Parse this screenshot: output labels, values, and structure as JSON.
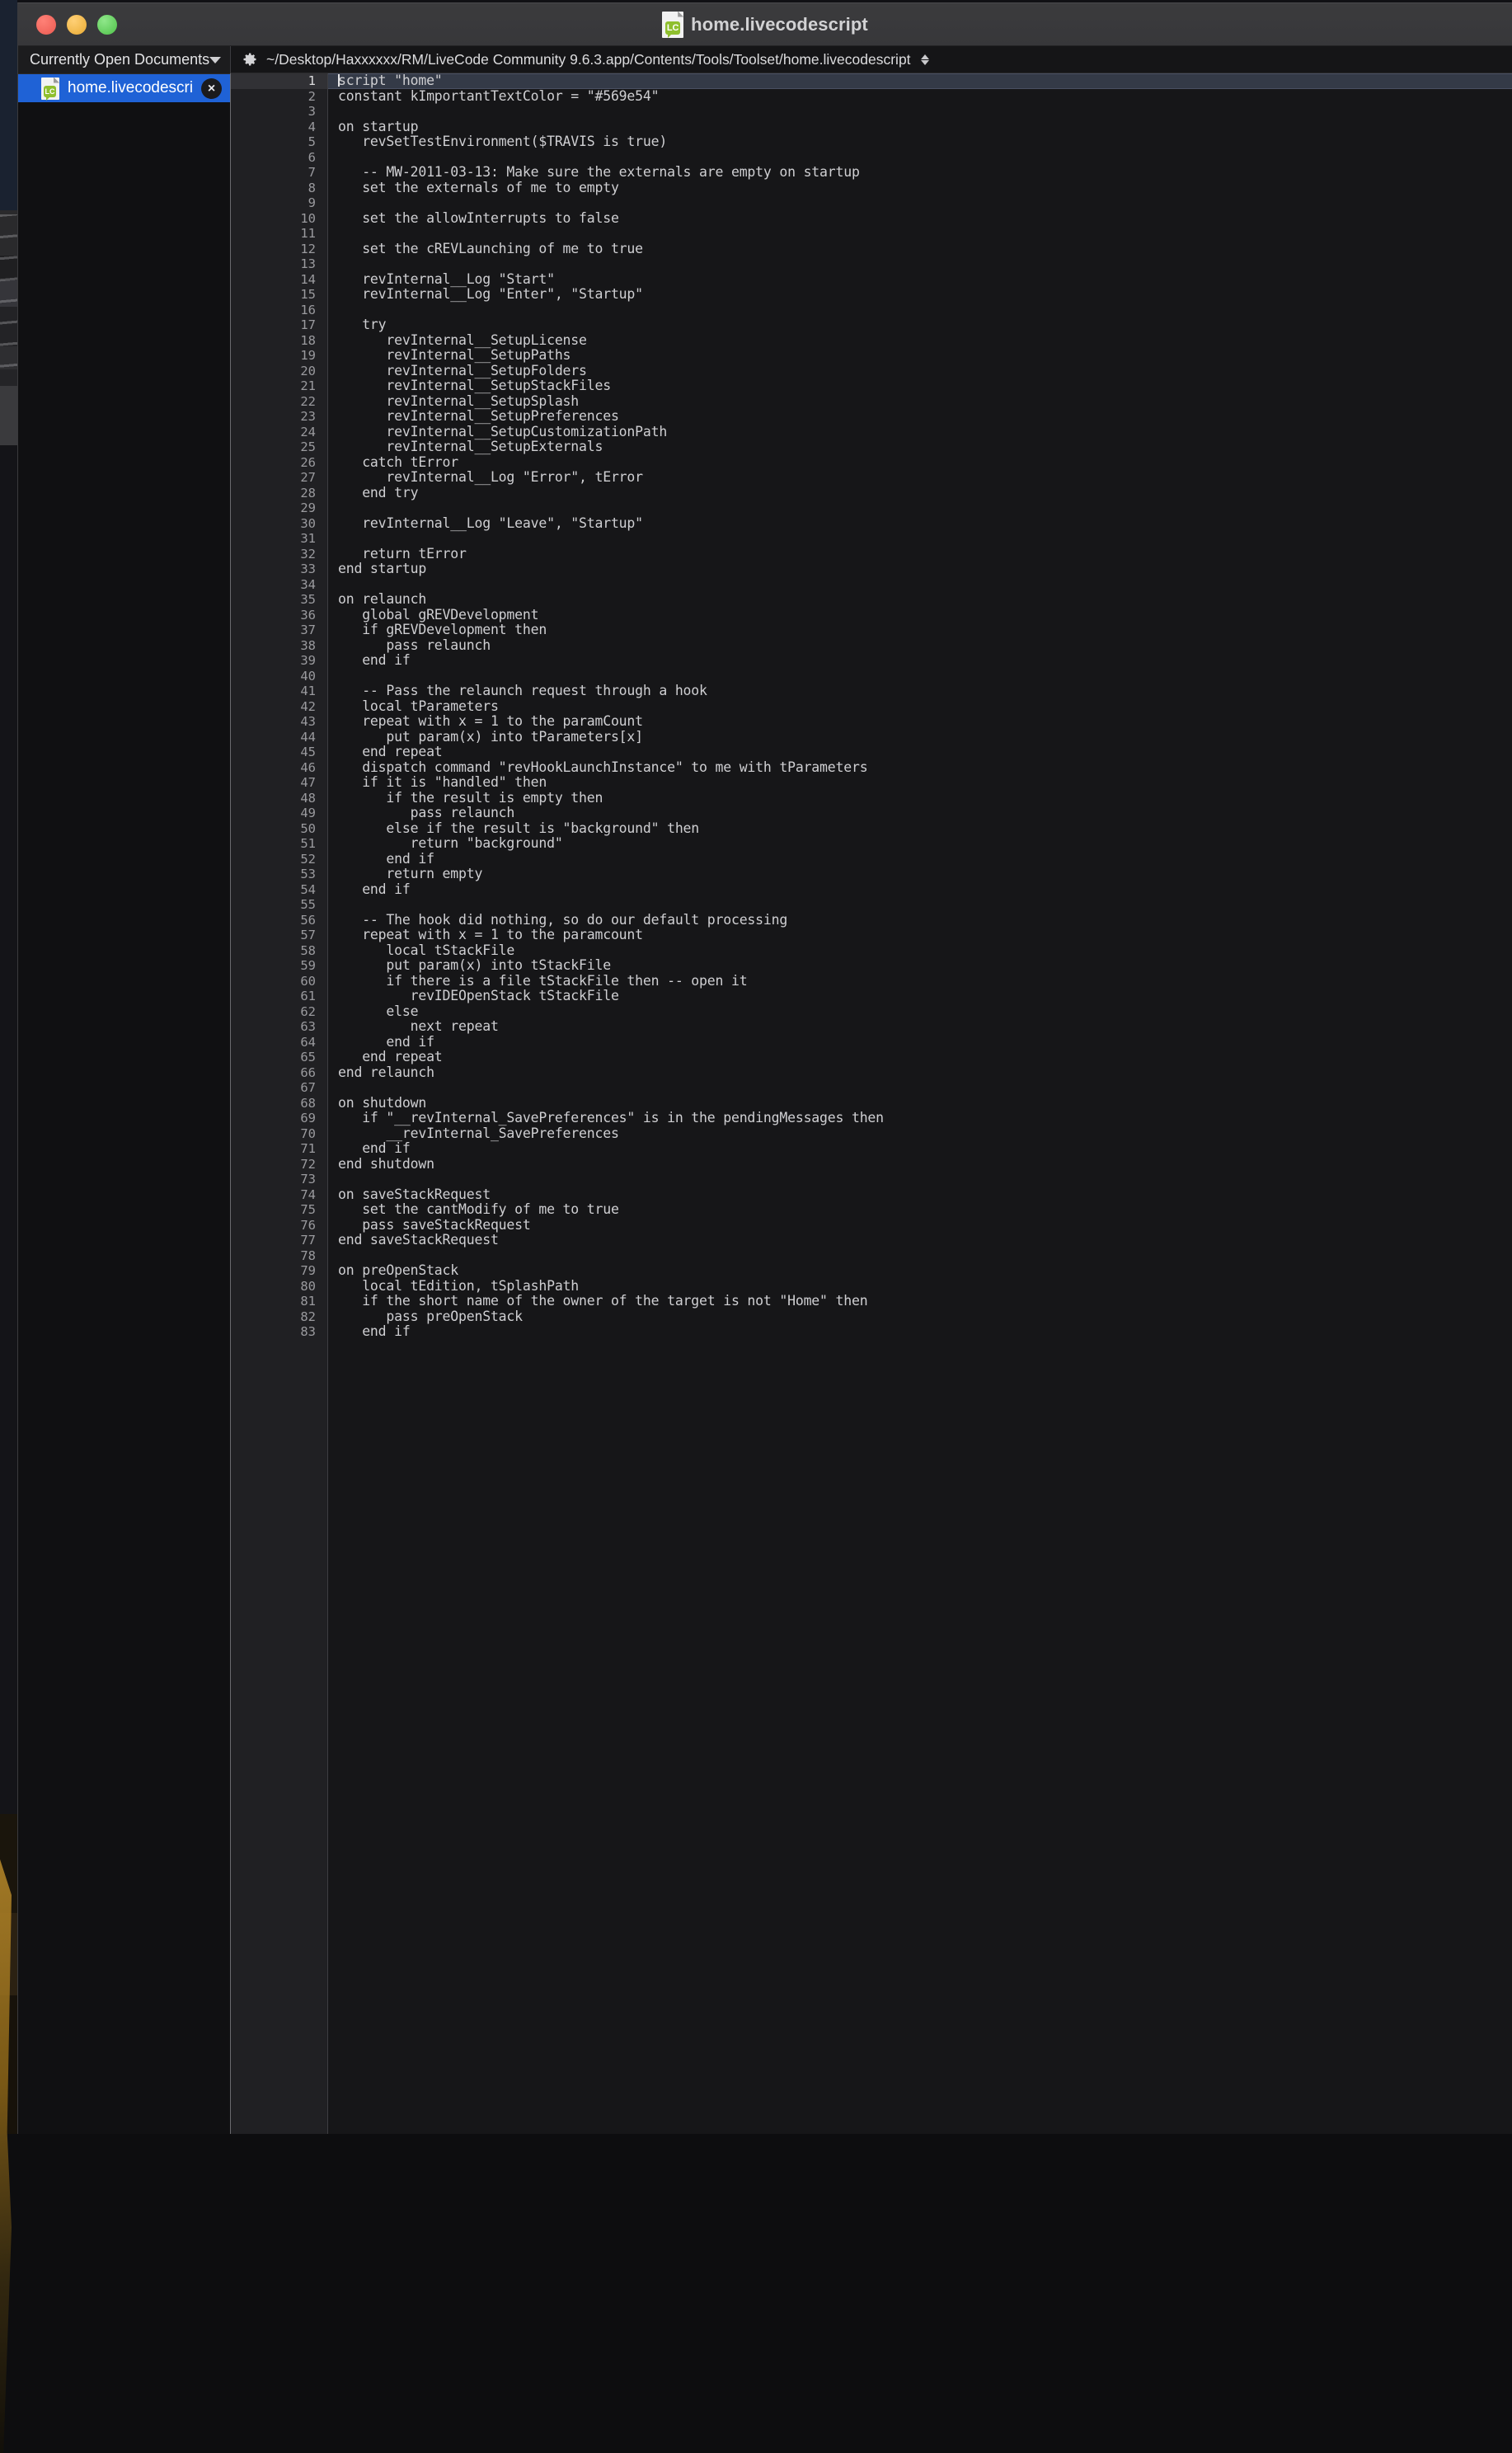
{
  "window": {
    "title": "home.livecodescript",
    "traffic_lights": [
      "close",
      "minimize",
      "zoom"
    ],
    "doc_icon": "livecode-document-icon",
    "icon_label": "LC"
  },
  "sidebar": {
    "header_label": "Currently Open Documents",
    "header_disclosure": "chevron-down-icon",
    "items": [
      {
        "name": "home.livecodescript",
        "icon": "livecode-document-icon",
        "close": "×",
        "selected": true
      }
    ]
  },
  "pathbar": {
    "gear": "gear-icon",
    "path": "~/Desktop/Haxxxxxx/RM/LiveCode Community 9.6.3.app/Contents/Tools/Toolset/home.livecodescript",
    "sort_control": "sort-updown-icon"
  },
  "editor": {
    "active_line": 1,
    "cursor_column": 1,
    "lines": [
      "script \"home\"",
      "constant kImportantTextColor = \"#569e54\"",
      "",
      "on startup",
      "   revSetTestEnvironment($TRAVIS is true)",
      "",
      "   -- MW-2011-03-13: Make sure the externals are empty on startup",
      "   set the externals of me to empty",
      "",
      "   set the allowInterrupts to false",
      "",
      "   set the cREVLaunching of me to true",
      "",
      "   revInternal__Log \"Start\"",
      "   revInternal__Log \"Enter\", \"Startup\"",
      "",
      "   try",
      "      revInternal__SetupLicense",
      "      revInternal__SetupPaths",
      "      revInternal__SetupFolders",
      "      revInternal__SetupStackFiles",
      "      revInternal__SetupSplash",
      "      revInternal__SetupPreferences",
      "      revInternal__SetupCustomizationPath",
      "      revInternal__SetupExternals",
      "   catch tError",
      "      revInternal__Log \"Error\", tError",
      "   end try",
      "",
      "   revInternal__Log \"Leave\", \"Startup\"",
      "",
      "   return tError",
      "end startup",
      "",
      "on relaunch",
      "   global gREVDevelopment",
      "   if gREVDevelopment then",
      "      pass relaunch",
      "   end if",
      "",
      "   -- Pass the relaunch request through a hook",
      "   local tParameters",
      "   repeat with x = 1 to the paramCount",
      "      put param(x) into tParameters[x]",
      "   end repeat",
      "   dispatch command \"revHookLaunchInstance\" to me with tParameters",
      "   if it is \"handled\" then",
      "      if the result is empty then",
      "         pass relaunch",
      "      else if the result is \"background\" then",
      "         return \"background\"",
      "      end if",
      "      return empty",
      "   end if",
      "",
      "   -- The hook did nothing, so do our default processing",
      "   repeat with x = 1 to the paramcount",
      "      local tStackFile",
      "      put param(x) into tStackFile",
      "      if there is a file tStackFile then -- open it",
      "         revIDEOpenStack tStackFile",
      "      else",
      "         next repeat",
      "      end if",
      "   end repeat",
      "end relaunch",
      "",
      "on shutdown",
      "   if \"__revInternal_SavePreferences\" is in the pendingMessages then",
      "      __revInternal_SavePreferences",
      "   end if",
      "end shutdown",
      "",
      "on saveStackRequest",
      "   set the cantModify of me to true",
      "   pass saveStackRequest",
      "end saveStackRequest",
      "",
      "on preOpenStack",
      "   local tEdition, tSplashPath",
      "   if the short name of the owner of the target is not \"Home\" then",
      "      pass preOpenStack",
      "   end if"
    ]
  },
  "colors": {
    "titlebar": "#3b3b3d",
    "selection_blue": "#1f62d6",
    "editor_bg": "#161618",
    "gutter_bg": "#202023",
    "active_line": "#343a47",
    "code_text": "#cfcfd2"
  }
}
